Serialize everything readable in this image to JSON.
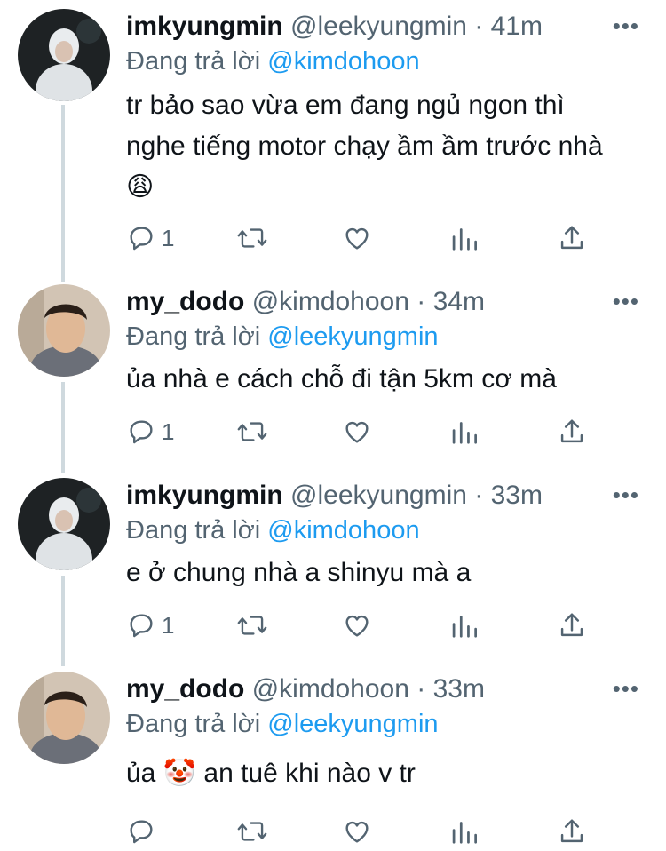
{
  "tweets": [
    {
      "name": "imkyungmin",
      "handle": "@leekyungmin",
      "time": "41m",
      "reply_prefix": "Đang trả lời",
      "reply_to": "@kimdohoon",
      "text": "tr bảo sao vừa em đang ngủ ngon thì nghe tiếng motor chạy ầm ầm trước nhà 😩",
      "reply_count": "1",
      "avatar_color": "#1e2224"
    },
    {
      "name": "my_dodo",
      "handle": "@kimdohoon",
      "time": "34m",
      "reply_prefix": "Đang trả lời",
      "reply_to": "@leekyungmin",
      "text": "ủa nhà e cách chỗ đi tận 5km cơ mà",
      "reply_count": "1",
      "avatar_color": "#c9a88e"
    },
    {
      "name": "imkyungmin",
      "handle": "@leekyungmin",
      "time": "33m",
      "reply_prefix": "Đang trả lời",
      "reply_to": "@kimdohoon",
      "text": "e ở chung nhà a shinyu mà a",
      "reply_count": "1",
      "avatar_color": "#1e2224"
    },
    {
      "name": "my_dodo",
      "handle": "@kimdohoon",
      "time": "33m",
      "reply_prefix": "Đang trả lời",
      "reply_to": "@leekyungmin",
      "text": "ủa 🤡  an tuê khi nào v tr",
      "reply_count": "",
      "avatar_color": "#c9a88e"
    }
  ],
  "separator": "·",
  "more_icon": "ellipsis-icon",
  "action_icons": [
    "reply-icon",
    "retweet-icon",
    "like-icon",
    "analytics-icon",
    "share-icon"
  ],
  "colors": {
    "mention": "#1d9bf0",
    "secondary": "#536471",
    "thread_line": "#cfd9de"
  }
}
